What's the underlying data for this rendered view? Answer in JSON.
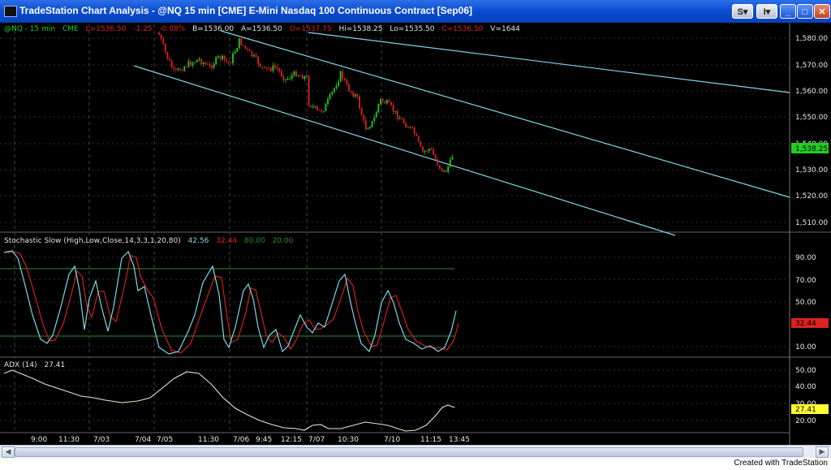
{
  "window": {
    "title": "TradeStation Chart Analysis - @NQ  15 min  [CME] E-Mini Nasdaq 100 Continuous Contract [Sep06]",
    "buttons": {
      "s": "S",
      "i": "I"
    }
  },
  "price_info": {
    "symbol": "@NQ - 15 min",
    "exchange": "CME",
    "last": "L=1536.50",
    "change": "-1.25",
    "change_pct": "-0.08%",
    "bid": "B=1536.00",
    "ask": "A=1536.50",
    "open": "O=1537.75",
    "high": "Hi=1538.25",
    "low": "Lo=1535.50",
    "close": "C=1536.50",
    "volume": "V=1644"
  },
  "price_axis": {
    "ticks": [
      "1,580.00",
      "1,570.00",
      "1,560.00",
      "1,550.00",
      "1,540.00",
      "1,530.00",
      "1,520.00",
      "1,510.00"
    ],
    "last_marker": "1,538.25"
  },
  "stochastic": {
    "label": "Stochastic Slow (High,Low,Close,14,3,3,1,20,80)",
    "values": [
      "42.56",
      "32.44",
      "80.00",
      "20.00"
    ],
    "ticks": [
      "90.00",
      "70.00",
      "50.00",
      "10.00"
    ],
    "marker": "32.44"
  },
  "adx": {
    "label": "ADX (14)",
    "value": "27.41",
    "ticks": [
      "50.00",
      "40.00",
      "30.00",
      "20.00"
    ],
    "marker": "27.41"
  },
  "time_axis": [
    "9:00",
    "11:30",
    "7/03",
    "7/04",
    "7/05",
    "11:30",
    "7/06",
    "9:45",
    "12:15",
    "7/07",
    "10:30",
    "7/10",
    "11:15",
    "13:45"
  ],
  "colors": {
    "background": "#000000",
    "up_candle": "#22cc22",
    "down_candle": "#dd2222",
    "trendline": "#7fd6e6",
    "stoch_k": "#7fd6e6",
    "stoch_d": "#cc2222",
    "level_line": "#2e8b2e",
    "adx_line": "#e8e8c8",
    "marker_green": "#22cc22",
    "marker_red": "#dd2222",
    "marker_yellow": "#ffff33"
  },
  "footer": {
    "credit": "Created with TradeStation"
  }
}
